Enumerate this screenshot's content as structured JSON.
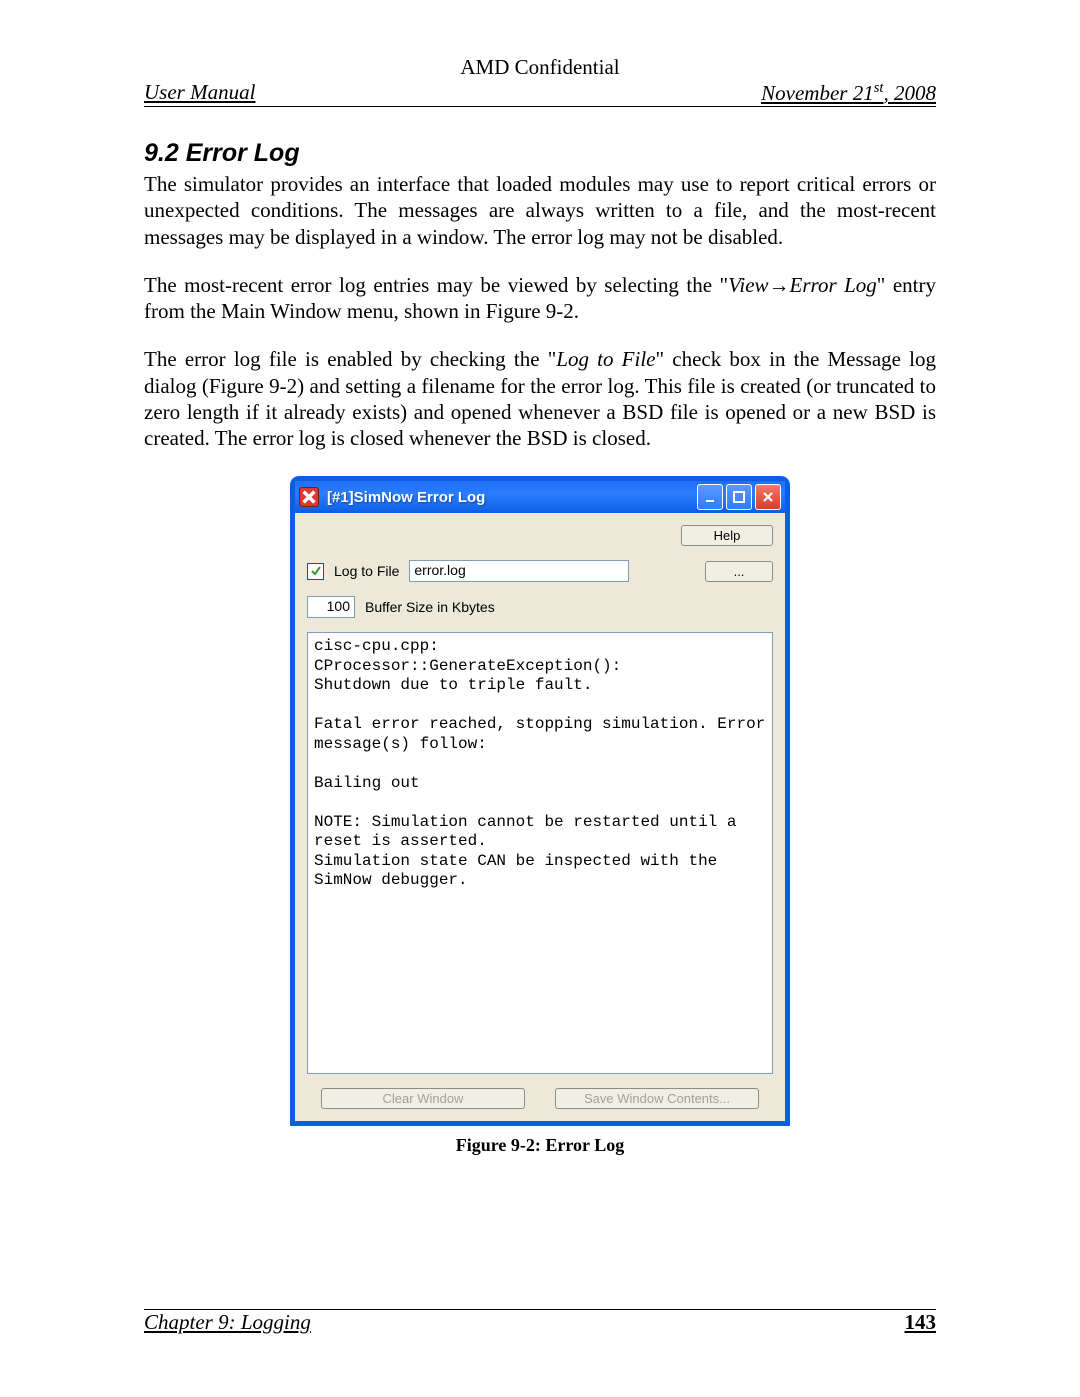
{
  "header": {
    "confidential": "AMD Confidential",
    "left": "User Manual",
    "right_html": "November 21",
    "right_sup": "st",
    "right_tail": ", 2008"
  },
  "section": {
    "number_title": "9.2  Error Log"
  },
  "paragraphs": {
    "p1": "The simulator provides an interface that loaded modules may use to report critical errors or unexpected conditions. The messages are always written to a file, and the most-recent messages may be displayed in a window. The error log may not be disabled.",
    "p2_a": "The most-recent error log entries may be viewed by selecting the \"",
    "p2_i": "View→Error Log",
    "p2_b": "\" entry from the Main Window menu, shown in Figure 9-2.",
    "p3_a": "The error log file is enabled by checking the \"",
    "p3_i": "Log to File",
    "p3_b": "\" check box in the Message log dialog (Figure 9-2) and setting a filename for the error log. This file is created (or truncated to zero length if it already exists) and opened whenever a BSD file is opened or a new BSD is created. The error log is closed whenever the BSD is closed."
  },
  "window": {
    "title": "[#1]SimNow Error Log",
    "help_btn": "Help",
    "log_to_file_label": "Log to File",
    "filename_value": "error.log",
    "browse_btn": "...",
    "buffer_value": "100",
    "buffer_label": "Buffer Size in Kbytes",
    "log_text": "cisc-cpu.cpp:\nCProcessor::GenerateException():\nShutdown due to triple fault.\n\nFatal error reached, stopping simulation. Error message(s) follow:\n\nBailing out\n\nNOTE: Simulation cannot be restarted until a reset is asserted.\nSimulation state CAN be inspected with the SimNow debugger.",
    "clear_btn": "Clear Window",
    "save_btn": "Save Window Contents..."
  },
  "caption": "Figure 9-2: Error Log",
  "footer": {
    "chapter": "Chapter 9: Logging",
    "page": "143"
  },
  "icons": {
    "close_x": "×"
  }
}
